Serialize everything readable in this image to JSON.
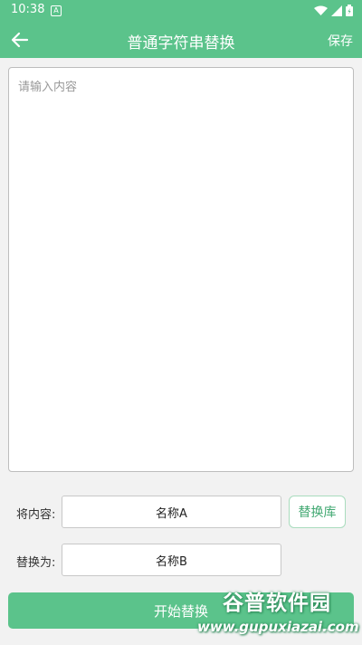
{
  "status_bar": {
    "time": "10:38",
    "notification_letter": "A",
    "icons": [
      "wifi-icon",
      "signal-icon",
      "battery-icon"
    ]
  },
  "app_bar": {
    "title": "普通字符串替换",
    "save_label": "保存",
    "back_icon": "back-arrow-icon"
  },
  "editor": {
    "placeholder": "请输入内容"
  },
  "replace": {
    "source_label": "将内容:",
    "source_value": "名称A",
    "library_button": "替换库",
    "target_label": "替换为:",
    "target_value": "名称B"
  },
  "start_button": "开始替换",
  "watermark": {
    "brand": "谷普软件园",
    "url": "www.gupuxiazai.com"
  },
  "colors": {
    "accent": "#5bc38b",
    "background": "#f2f2f2"
  }
}
